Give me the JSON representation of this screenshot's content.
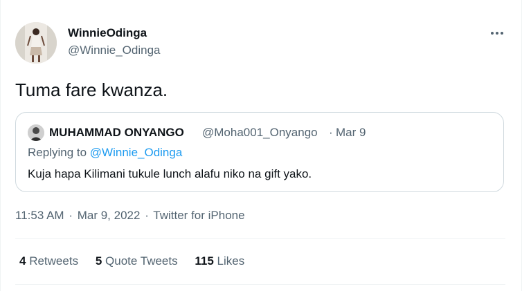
{
  "tweet": {
    "author": {
      "display_name": "WinnieOdinga",
      "handle": "@Winnie_Odinga"
    },
    "text": "Tuma fare kwanza.",
    "more_icon": "more-horizontal-icon",
    "quote": {
      "author_name": "MUHAMMAD ONYANGO",
      "author_handle": "@Moha001_Onyango",
      "separator": "·",
      "date": "Mar 9",
      "replying_prefix": "Replying to",
      "replying_handle": "@Winnie_Odinga",
      "text": "Kuja hapa Kilimani tukule lunch alafu niko na gift yako."
    },
    "meta": {
      "time": "11:53 AM",
      "separator": "·",
      "date": "Mar 9, 2022",
      "source": "Twitter for iPhone"
    },
    "stats": {
      "retweets_count": "4",
      "retweets_label": "Retweets",
      "quotes_count": "5",
      "quotes_label": "Quote Tweets",
      "likes_count": "115",
      "likes_label": "Likes"
    }
  },
  "colors": {
    "primary_text": "#0f1419",
    "secondary_text": "#536471",
    "link": "#1d9bf0",
    "border": "#cfd9de",
    "divider": "#eff3f4"
  }
}
